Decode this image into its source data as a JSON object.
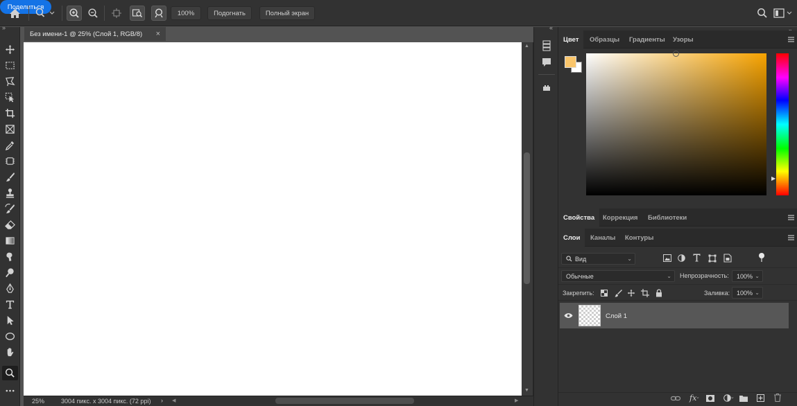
{
  "topbar": {
    "zoom_value": "100%",
    "fit_button": "Подогнать",
    "fullscreen_button": "Полный экран",
    "share_button": "Поделиться"
  },
  "document": {
    "tab_title": "Без имени-1 @ 25% (Слой 1, RGB/8)",
    "close_glyph": "×"
  },
  "status": {
    "zoom": "25%",
    "doc_info": "3004 пикс. x 3004 пикс. (72 ppi)"
  },
  "color_panel": {
    "tabs": [
      "Цвет",
      "Образцы",
      "Градиенты",
      "Узоры"
    ],
    "foreground": "#f9c56b",
    "background": "#ffffff"
  },
  "properties_panel": {
    "tabs": [
      "Свойства",
      "Коррекция",
      "Библиотеки"
    ]
  },
  "layers_panel": {
    "tabs": [
      "Слои",
      "Каналы",
      "Контуры"
    ],
    "filter_placeholder": "Вид",
    "blend_mode": "Обычные",
    "opacity_label": "Непрозрачность:",
    "opacity_value": "100%",
    "lock_label": "Закрепить:",
    "fill_label": "Заливка:",
    "fill_value": "100%",
    "layers": [
      {
        "name": "Слой 1",
        "visible": true
      }
    ]
  },
  "icons": [
    "home-icon",
    "zoom-icon",
    "zoom-in-icon",
    "zoom-out-icon",
    "move-icon",
    "marquee-icon",
    "lasso-icon",
    "quick-select-icon",
    "crop-icon",
    "frame-icon",
    "eyedropper-icon",
    "healing-icon",
    "brush-icon",
    "stamp-icon",
    "history-brush-icon",
    "eraser-icon",
    "gradient-icon",
    "smudge-icon",
    "dodge-icon",
    "pen-icon",
    "type-icon",
    "path-select-icon",
    "ellipse-icon",
    "hand-icon",
    "search-icon",
    "workspace-icon",
    "eye-icon"
  ],
  "colors": {
    "accent": "#1473e6",
    "panel_bg": "#323232",
    "app_bg": "#535353"
  }
}
